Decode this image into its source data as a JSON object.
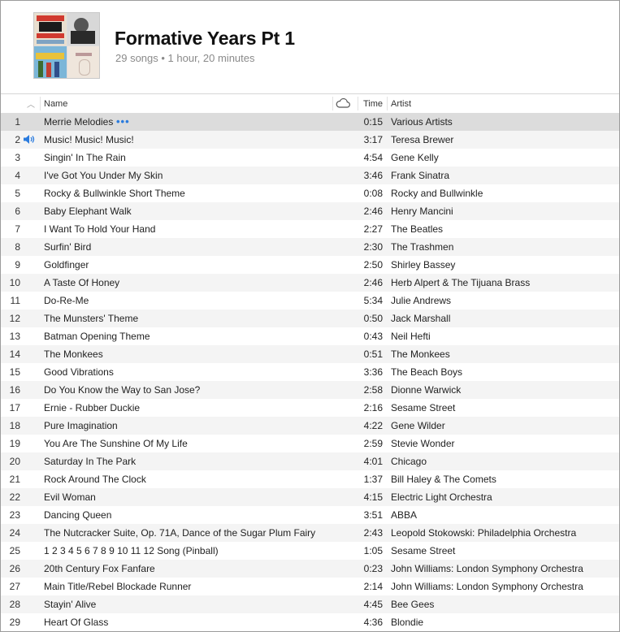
{
  "playlist": {
    "title": "Formative Years Pt 1",
    "subtitle": "29 songs • 1 hour, 20 minutes"
  },
  "columns": {
    "name": "Name",
    "time": "Time",
    "artist": "Artist"
  },
  "icons": {
    "sort": "sort-ascending-icon",
    "cloud": "icloud-status-icon",
    "speaker": "now-playing-speaker-icon",
    "more": "more-actions-icon"
  },
  "colors": {
    "accent": "#2a7bde",
    "selected_row": "#dcdcdc",
    "alt_row": "#f4f4f4"
  },
  "selected_index": 0,
  "playing_index": 1,
  "tracks": [
    {
      "num": "1",
      "name": "Merrie Melodies",
      "time": "0:15",
      "artist": "Various Artists"
    },
    {
      "num": "2",
      "name": "Music! Music! Music!",
      "time": "3:17",
      "artist": "Teresa Brewer"
    },
    {
      "num": "3",
      "name": "Singin' In The Rain",
      "time": "4:54",
      "artist": "Gene Kelly"
    },
    {
      "num": "4",
      "name": "I've Got You Under My Skin",
      "time": "3:46",
      "artist": "Frank Sinatra"
    },
    {
      "num": "5",
      "name": "Rocky & Bullwinkle Short Theme",
      "time": "0:08",
      "artist": "Rocky and Bullwinkle"
    },
    {
      "num": "6",
      "name": "Baby Elephant Walk",
      "time": "2:46",
      "artist": "Henry Mancini"
    },
    {
      "num": "7",
      "name": "I Want To Hold Your Hand",
      "time": "2:27",
      "artist": "The Beatles"
    },
    {
      "num": "8",
      "name": "Surfin' Bird",
      "time": "2:30",
      "artist": "The Trashmen"
    },
    {
      "num": "9",
      "name": "Goldfinger",
      "time": "2:50",
      "artist": "Shirley Bassey"
    },
    {
      "num": "10",
      "name": "A Taste Of Honey",
      "time": "2:46",
      "artist": "Herb Alpert & The Tijuana Brass"
    },
    {
      "num": "11",
      "name": "Do-Re-Me",
      "time": "5:34",
      "artist": "Julie Andrews"
    },
    {
      "num": "12",
      "name": "The Munsters' Theme",
      "time": "0:50",
      "artist": "Jack Marshall"
    },
    {
      "num": "13",
      "name": "Batman Opening Theme",
      "time": "0:43",
      "artist": "Neil Hefti"
    },
    {
      "num": "14",
      "name": "The Monkees",
      "time": "0:51",
      "artist": "The Monkees"
    },
    {
      "num": "15",
      "name": "Good Vibrations",
      "time": "3:36",
      "artist": "The Beach Boys"
    },
    {
      "num": "16",
      "name": "Do You Know the Way to San Jose?",
      "time": "2:58",
      "artist": "Dionne Warwick"
    },
    {
      "num": "17",
      "name": "Ernie - Rubber Duckie",
      "time": "2:16",
      "artist": "Sesame Street"
    },
    {
      "num": "18",
      "name": "Pure Imagination",
      "time": "4:22",
      "artist": "Gene Wilder"
    },
    {
      "num": "19",
      "name": "You Are The Sunshine Of My Life",
      "time": "2:59",
      "artist": "Stevie Wonder"
    },
    {
      "num": "20",
      "name": "Saturday In The Park",
      "time": "4:01",
      "artist": "Chicago"
    },
    {
      "num": "21",
      "name": "Rock Around The Clock",
      "time": "1:37",
      "artist": "Bill Haley & The Comets"
    },
    {
      "num": "22",
      "name": "Evil Woman",
      "time": "4:15",
      "artist": "Electric Light Orchestra"
    },
    {
      "num": "23",
      "name": "Dancing Queen",
      "time": "3:51",
      "artist": "ABBA"
    },
    {
      "num": "24",
      "name": "The Nutcracker Suite, Op. 71A, Dance of the Sugar Plum Fairy",
      "time": "2:43",
      "artist": "Leopold Stokowski: Philadelphia Orchestra"
    },
    {
      "num": "25",
      "name": "1 2 3 4 5 6 7 8 9 10 11 12 Song (Pinball)",
      "time": "1:05",
      "artist": "Sesame Street"
    },
    {
      "num": "26",
      "name": "20th Century Fox Fanfare",
      "time": "0:23",
      "artist": "John Williams: London Symphony Orchestra"
    },
    {
      "num": "27",
      "name": "Main Title/Rebel Blockade Runner",
      "time": "2:14",
      "artist": "John Williams: London Symphony Orchestra"
    },
    {
      "num": "28",
      "name": "Stayin' Alive",
      "time": "4:45",
      "artist": "Bee Gees"
    },
    {
      "num": "29",
      "name": "Heart Of Glass",
      "time": "4:36",
      "artist": "Blondie"
    }
  ]
}
